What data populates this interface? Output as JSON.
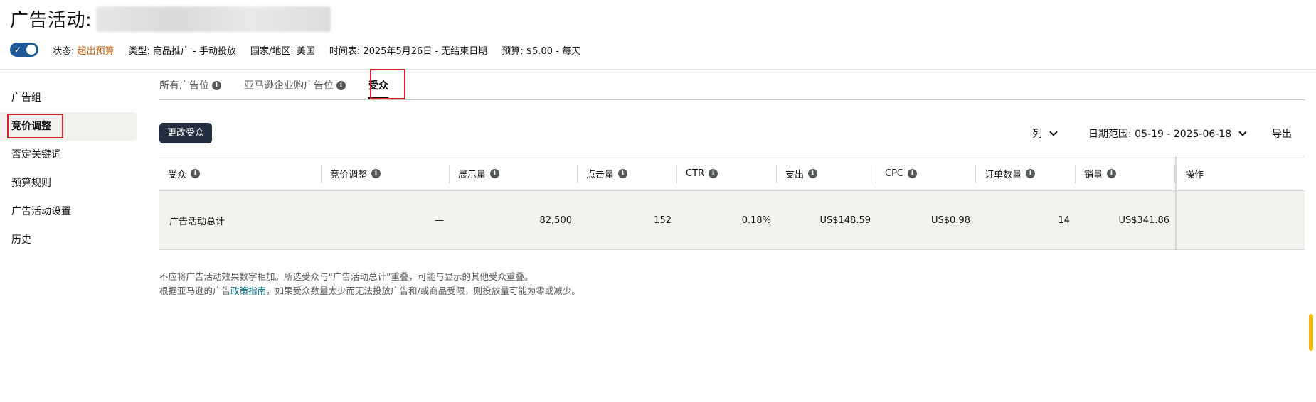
{
  "header": {
    "title": "广告活动: "
  },
  "meta": {
    "status_label": "状态: ",
    "status_value": "超出预算",
    "type": "类型: 商品推广 - 手动投放",
    "country": "国家/地区: 美国",
    "schedule": "时间表: 2025年5月26日 - 无结束日期",
    "budget": "预算: $5.00 - 每天"
  },
  "sidebar": {
    "items": [
      {
        "label": "广告组"
      },
      {
        "label": "竞价调整"
      },
      {
        "label": "否定关键词"
      },
      {
        "label": "预算规则"
      },
      {
        "label": "广告活动设置"
      },
      {
        "label": "历史"
      }
    ]
  },
  "tabs": [
    {
      "label": "所有广告位"
    },
    {
      "label": "亚马逊企业购广告位"
    },
    {
      "label": "受众"
    }
  ],
  "toolbar": {
    "change_audience": "更改受众",
    "columns": "列",
    "date_range": "日期范围: 05-19 - 2025-06-18",
    "export": "导出"
  },
  "table": {
    "headers": [
      "受众",
      "竞价调整",
      "展示量",
      "点击量",
      "CTR",
      "支出",
      "CPC",
      "订单数量",
      "销量",
      "操作"
    ],
    "total_row": {
      "label": "广告活动总计",
      "bid_adjustment": "—",
      "impressions": "82,500",
      "clicks": "152",
      "ctr": "0.18%",
      "spend": "US$148.59",
      "cpc": "US$0.98",
      "orders": "14",
      "sales": "US$341.86"
    }
  },
  "footnote": {
    "line1": "不应将广告活动效果数字相加。所选受众与“广告活动总计”重叠，可能与显示的其他受众重叠。",
    "line2_prefix": "根据亚马逊的广告",
    "line2_link": "政策指南",
    "line2_suffix": "，如果受众数量太少而无法投放广告和/或商品受限，则投放量可能为零或减少。"
  },
  "colors": {
    "accent_dark": "#232f3e",
    "toggle": "#1f5a96",
    "warning": "#c45500",
    "highlight_box": "#d5262e",
    "link": "#007185"
  }
}
